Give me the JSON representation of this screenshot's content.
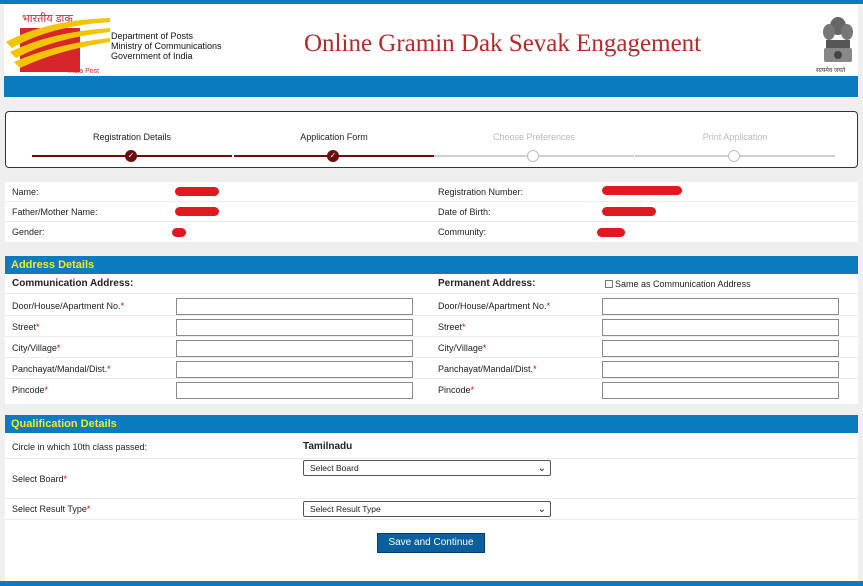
{
  "header": {
    "logo_hindi": "भारतीय डाक",
    "logo_caption": "India Post",
    "department": [
      "Department of Posts",
      "Ministry of Communications",
      "Government of India"
    ],
    "title": "Online Gramin Dak Sevak Engagement",
    "emblem_caption": "सत्यमेव जयते",
    "colors": {
      "title": "#b32a2a",
      "bar": "#0a7bbf",
      "logo_red": "#d7262b",
      "logo_yellow": "#f3c500"
    }
  },
  "steps": [
    {
      "label": "Registration Details",
      "status": "done"
    },
    {
      "label": "Application Form",
      "status": "done"
    },
    {
      "label": "Choose Preferences",
      "status": "pending"
    },
    {
      "label": "Print Application",
      "status": "pending"
    }
  ],
  "applicant": {
    "name_label": "Name:",
    "parent_label": "Father/Mother Name:",
    "gender_label": "Gender:",
    "regno_label": "Registration Number:",
    "dob_label": "Date of Birth:",
    "community_label": "Community:"
  },
  "address": {
    "title": "Address Details",
    "communication_title": "Communication Address:",
    "permanent_title": "Permanent Address:",
    "same_as_label": "Same as Communication Address",
    "fields": [
      {
        "label": "Door/House/Apartment No.",
        "required": "*"
      },
      {
        "label": "Street",
        "required": "*"
      },
      {
        "label": "City/Village",
        "required": "*"
      },
      {
        "label": "Panchayat/Mandal/Dist.",
        "required": "*"
      },
      {
        "label": "Pincode",
        "required": "*"
      }
    ]
  },
  "qualification": {
    "title": "Qualification Details",
    "circle_label": "Circle in which 10th class passed:",
    "circle_value": "Tamilnadu",
    "board_label": "Select Board",
    "board_required": "*",
    "board_selected": "Select Board",
    "result_label": "Select Result Type",
    "result_required": "*",
    "result_selected": "Select Result Type",
    "submit_label": "Save and Continue"
  }
}
